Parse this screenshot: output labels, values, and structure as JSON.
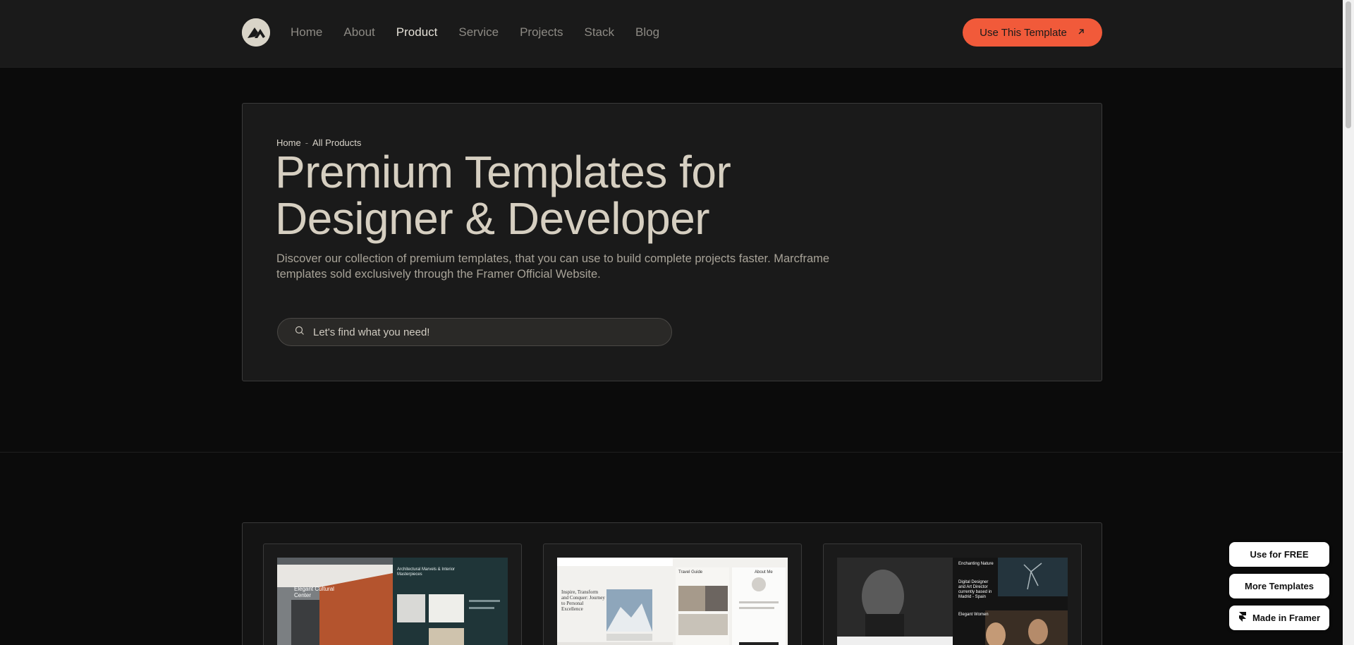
{
  "header": {
    "nav": [
      {
        "label": "Home",
        "active": false
      },
      {
        "label": "About",
        "active": false
      },
      {
        "label": "Product",
        "active": true
      },
      {
        "label": "Service",
        "active": false
      },
      {
        "label": "Projects",
        "active": false
      },
      {
        "label": "Stack",
        "active": false
      },
      {
        "label": "Blog",
        "active": false
      }
    ],
    "cta_label": "Use This Template",
    "logo_icon": "mountain-logo-icon"
  },
  "hero": {
    "breadcrumb": {
      "home": "Home",
      "separator": "-",
      "current": "All Products"
    },
    "title_line1": "Premium Templates for",
    "title_line2": "Designer & Developer",
    "description": "Discover our collection of premium templates, that you can use to build complete projects faster. Marcframe templates sold exclusively through the Framer Official Website.",
    "search_placeholder": "Let's find what you need!"
  },
  "products": {
    "card1": {
      "nav_badge": "",
      "headline_left": "Elegant Cultural Center",
      "headline_right": "Architectural Marvels & Interior Masterpieces"
    },
    "card2": {
      "headline_left": "Inspire, Transform and Conquer: Journey to Personal Excellence",
      "header_center": "Travel Guide",
      "header_right": "About Me"
    },
    "card3": {
      "headline_left": "Digital Designer and Art Director currently based in Madrid - Spain",
      "header_right": "Enchanting Nature",
      "caption_right": "Elegant Women"
    }
  },
  "floating": {
    "free_label": "Use for FREE",
    "more_label": "More Templates",
    "framer_label": "Made in Framer"
  },
  "colors": {
    "accent": "#f15a3a",
    "background": "#0b0b0b",
    "surface": "#1a1a1a",
    "title": "#d6cfc1"
  }
}
